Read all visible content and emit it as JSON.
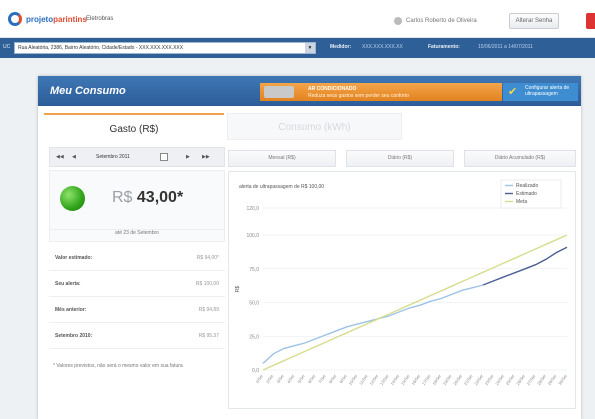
{
  "header": {
    "logo_part1": "projeto",
    "logo_part2": "parintins",
    "brand_sub": "Eletrobras",
    "user_name": "Carlos Roberto de Oliveira",
    "change_password_label": "Alterar Senha"
  },
  "address_bar": {
    "uc_label": "UC",
    "address_value": "Rua Aleatória, 2386, Bairro Aleatório, Cidade/Estado - XXX.XXX.XXX.XXX",
    "meter_label": "Medidor:",
    "meter_value": "XXX.XXX.XXX.XX",
    "billing_label": "Faturamento:",
    "billing_value": "15/06/2011 a 14/07/2011"
  },
  "card": {
    "title": "Meu Consumo",
    "ac_title": "AR CONDICIONADO",
    "ac_sub": "Reduza seus gastos sem perder seu conforto",
    "alert_button": "Configurar alerta de ultrapassagem"
  },
  "tabs": {
    "gasto": "Gasto (R$)",
    "consumo": "Consumo (kWh)"
  },
  "month_nav": {
    "first": "◀◀",
    "prev": "◀",
    "month": "Setembro 2011",
    "next": "▶",
    "last": "▶▶"
  },
  "summary": {
    "currency": "R$",
    "amount": "43,00*",
    "date_note": "até 23 de Setembro"
  },
  "info_rows": [
    {
      "label": "Valor estimado:",
      "value": "R$ 94,00*"
    },
    {
      "label": "Seu alerta:",
      "value": "R$ 100,00"
    },
    {
      "label": "Mês anterior:",
      "value": "R$ 94,89"
    },
    {
      "label": "Setembro 2010:",
      "value": "R$ 95,37"
    }
  ],
  "footnote": "* Valores previstos, não será o mesmo valor em sua fatura",
  "subtabs": [
    "Mensal (R$)",
    "Diário (R$)",
    "Diário Acumulado (R$)"
  ],
  "chart_data": {
    "type": "line",
    "title": "alerta de ultrapassagem de R$ 100,00",
    "ylabel": "R$",
    "xlabel": "",
    "ylim": [
      0,
      120
    ],
    "y_ticks": [
      "0,0",
      "25,0",
      "50,0",
      "75,0",
      "100,0",
      "120,0"
    ],
    "y_tick_values": [
      0,
      25,
      50,
      75,
      100,
      120
    ],
    "categories": [
      "1/Set",
      "2/Set",
      "3/Set",
      "4/Set",
      "5/Set",
      "6/Set",
      "7/Set",
      "8/Set",
      "9/Set",
      "10/Set",
      "11/Set",
      "12/Set",
      "13/Set",
      "14/Set",
      "15/Set",
      "16/Set",
      "17/Set",
      "18/Set",
      "19/Set",
      "20/Set",
      "21/Set",
      "22/Set",
      "23/Set",
      "24/Set",
      "25/Set",
      "26/Set",
      "27/Set",
      "28/Set",
      "29/Set",
      "30/Set"
    ],
    "legend_position": "top-right",
    "grid": true,
    "series": [
      {
        "name": "Realizado",
        "color": "#9cc3e6",
        "values": [
          5,
          12,
          16,
          18,
          20,
          23,
          26,
          29,
          32,
          34,
          36,
          38,
          40,
          43,
          46,
          48,
          51,
          53,
          56,
          59,
          61,
          63
        ]
      },
      {
        "name": "Estimado",
        "color": "#4a5f96",
        "values": [
          null,
          null,
          null,
          null,
          null,
          null,
          null,
          null,
          null,
          null,
          null,
          null,
          null,
          null,
          null,
          null,
          null,
          null,
          null,
          null,
          null,
          63,
          66,
          69,
          72,
          75,
          78,
          82,
          87,
          91
        ]
      },
      {
        "name": "Meta",
        "color": "#d7dd8e",
        "values": [
          0,
          3.45,
          6.9,
          10.34,
          13.79,
          17.24,
          20.69,
          24.14,
          27.59,
          31.03,
          34.48,
          37.93,
          41.38,
          44.83,
          48.28,
          51.72,
          55.17,
          58.62,
          62.07,
          65.52,
          68.97,
          72.41,
          75.86,
          79.31,
          82.76,
          86.21,
          89.66,
          93.1,
          96.55,
          100
        ]
      }
    ]
  }
}
